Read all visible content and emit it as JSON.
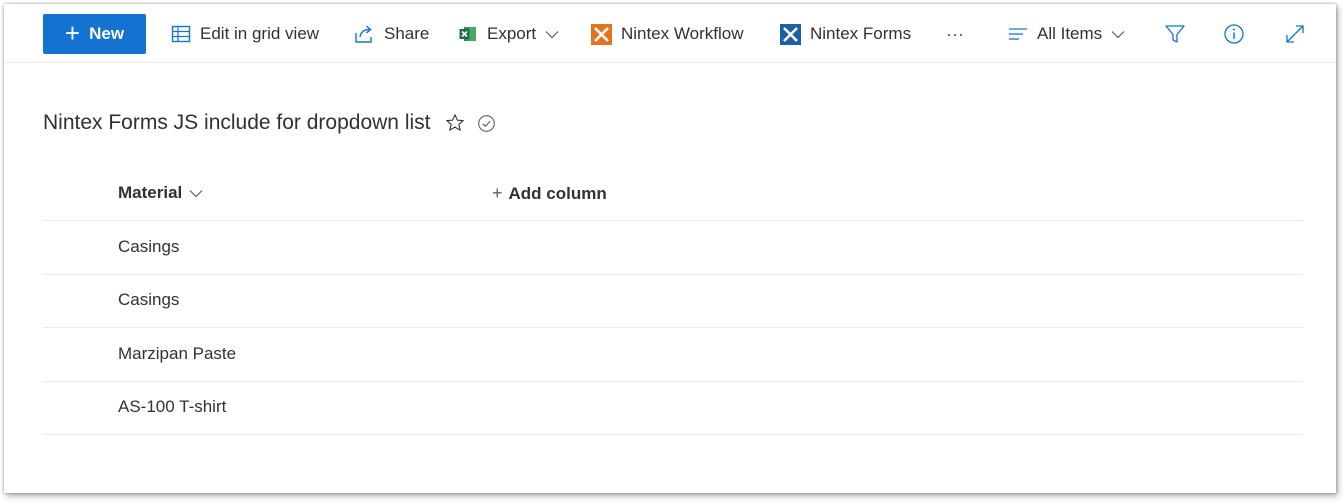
{
  "toolbar": {
    "new_label": "New",
    "edit_grid_label": "Edit in grid view",
    "share_label": "Share",
    "export_label": "Export",
    "nintex_workflow_label": "Nintex Workflow",
    "nintex_forms_label": "Nintex Forms",
    "more_label": "···",
    "view_label": "All Items"
  },
  "icons": {
    "new": "plus-icon",
    "edit_grid": "grid-icon",
    "share": "share-icon",
    "export": "excel-icon",
    "nintex_workflow": "nintex-workflow-icon",
    "nintex_forms": "nintex-forms-icon",
    "view": "list-lines-icon",
    "filter": "filter-icon",
    "info": "info-icon",
    "expand": "expand-icon",
    "favorite": "star-icon",
    "status": "check-circle-icon"
  },
  "colors": {
    "accent": "#1473d1",
    "excel": "#1d6f42",
    "nintex_workflow": "#e2731f",
    "nintex_forms": "#1b5fa8"
  },
  "list": {
    "title": "Nintex Forms JS include for dropdown list",
    "columns": {
      "material": "Material",
      "add_column": "Add column"
    },
    "rows": [
      "Casings",
      "Casings",
      "Marzipan Paste",
      "AS-100 T-shirt"
    ]
  }
}
